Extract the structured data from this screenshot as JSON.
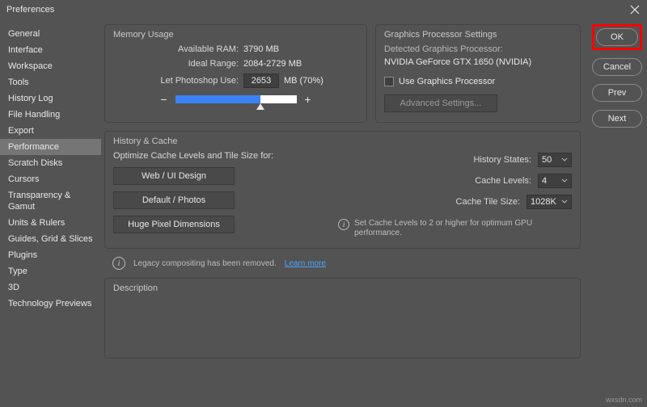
{
  "title": "Preferences",
  "sidebar": {
    "items": [
      {
        "label": "General"
      },
      {
        "label": "Interface"
      },
      {
        "label": "Workspace"
      },
      {
        "label": "Tools"
      },
      {
        "label": "History Log"
      },
      {
        "label": "File Handling"
      },
      {
        "label": "Export"
      },
      {
        "label": "Performance"
      },
      {
        "label": "Scratch Disks"
      },
      {
        "label": "Cursors"
      },
      {
        "label": "Transparency & Gamut"
      },
      {
        "label": "Units & Rulers"
      },
      {
        "label": "Guides, Grid & Slices"
      },
      {
        "label": "Plugins"
      },
      {
        "label": "Type"
      },
      {
        "label": "3D"
      },
      {
        "label": "Technology Previews"
      }
    ],
    "selected_index": 7
  },
  "buttons": {
    "ok": "OK",
    "cancel": "Cancel",
    "prev": "Prev",
    "next": "Next"
  },
  "memory": {
    "title": "Memory Usage",
    "available_label": "Available RAM:",
    "available_value": "3790 MB",
    "ideal_label": "Ideal Range:",
    "ideal_value": "2084-2729 MB",
    "use_label": "Let Photoshop Use:",
    "use_value": "2653",
    "use_suffix": "MB (70%)",
    "slider_percent": 70
  },
  "graphics": {
    "title": "Graphics Processor Settings",
    "detected_label": "Detected Graphics Processor:",
    "detected_value": "NVIDIA GeForce GTX 1650 (NVIDIA)",
    "use_gpu_label": "Use Graphics Processor",
    "advanced_label": "Advanced Settings..."
  },
  "history": {
    "title": "History & Cache",
    "optimize_label": "Optimize Cache Levels and Tile Size for:",
    "opts": [
      {
        "label": "Web / UI Design"
      },
      {
        "label": "Default / Photos"
      },
      {
        "label": "Huge Pixel Dimensions"
      }
    ],
    "states_label": "History States:",
    "states_value": "50",
    "levels_label": "Cache Levels:",
    "levels_value": "4",
    "tile_label": "Cache Tile Size:",
    "tile_value": "1028K",
    "info_text": "Set Cache Levels to 2 or higher for optimum GPU performance."
  },
  "legacy": {
    "text": "Legacy compositing has been removed.",
    "link": "Learn more"
  },
  "description": {
    "title": "Description"
  },
  "watermark": "wxsdn.com"
}
